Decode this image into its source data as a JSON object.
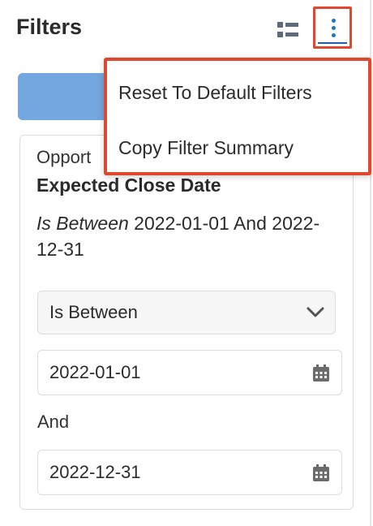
{
  "header": {
    "title": "Filters",
    "icons": [
      "list-view-icon",
      "more-options-icon"
    ]
  },
  "menu": {
    "items": [
      {
        "label": "Reset To Default Filters"
      },
      {
        "label": "Copy Filter Summary"
      }
    ]
  },
  "filter": {
    "module": "Opport",
    "field": "Expected Close Date",
    "summary_operator": "Is Between",
    "summary_rest": " 2022-01-01 And 2022-12-31",
    "operator_select": "Is Between",
    "start_date": "2022-01-01",
    "and_label": "And",
    "end_date": "2022-12-31"
  },
  "colors": {
    "highlight": "#e0472f",
    "accent": "#1a78c2",
    "button": "#74a7df"
  }
}
